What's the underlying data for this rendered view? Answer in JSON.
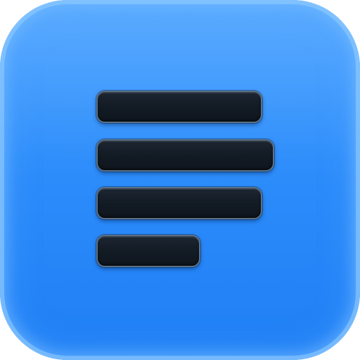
{
  "app_icon": {
    "glyph": "text-align-left-icon",
    "line_count": 4,
    "colors": {
      "background_top": "#4aa3ff",
      "background_bottom": "#1f7ff5",
      "rim_highlight": "#96cdff",
      "glyph_fill": "#121a23",
      "glyph_outline": "#5c7287"
    }
  }
}
